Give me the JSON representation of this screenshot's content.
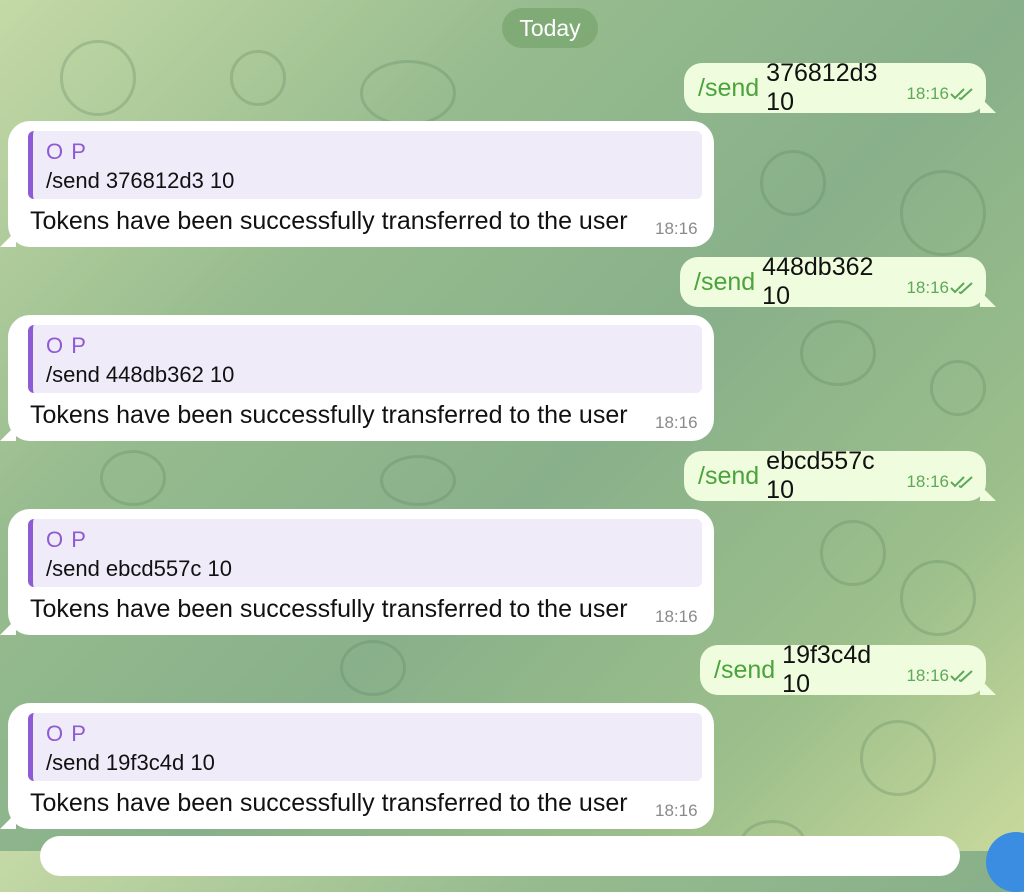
{
  "date_separator": "Today",
  "messages": [
    {
      "out": {
        "command": "/send",
        "argument": "376812d3 10",
        "time": "18:16"
      },
      "in": {
        "reply_author": "O P",
        "reply_text": "/send 376812d3 10",
        "text": "Tokens have been successfully transferred to the user",
        "time": "18:16"
      }
    },
    {
      "out": {
        "command": "/send",
        "argument": "448db362 10",
        "time": "18:16"
      },
      "in": {
        "reply_author": "O P",
        "reply_text": "/send 448db362 10",
        "text": "Tokens have been successfully transferred to the user",
        "time": "18:16"
      }
    },
    {
      "out": {
        "command": "/send",
        "argument": "ebcd557c 10",
        "time": "18:16"
      },
      "in": {
        "reply_author": "O P",
        "reply_text": "/send ebcd557c 10",
        "text": "Tokens have been successfully transferred to the user",
        "time": "18:16"
      }
    },
    {
      "out": {
        "command": "/send",
        "argument": "19f3c4d 10",
        "time": "18:16"
      },
      "in": {
        "reply_author": "O P",
        "reply_text": "/send 19f3c4d 10",
        "text": "Tokens have been successfully transferred to the user",
        "time": "18:16"
      }
    }
  ],
  "icons": {
    "read_receipt": "double-check-icon",
    "fab": "fab-button"
  },
  "colors": {
    "outgoing_bubble": "#effdde",
    "command_link": "#4aa33b",
    "reply_accent": "#8e5bd4",
    "incoming_bubble": "#ffffff"
  }
}
